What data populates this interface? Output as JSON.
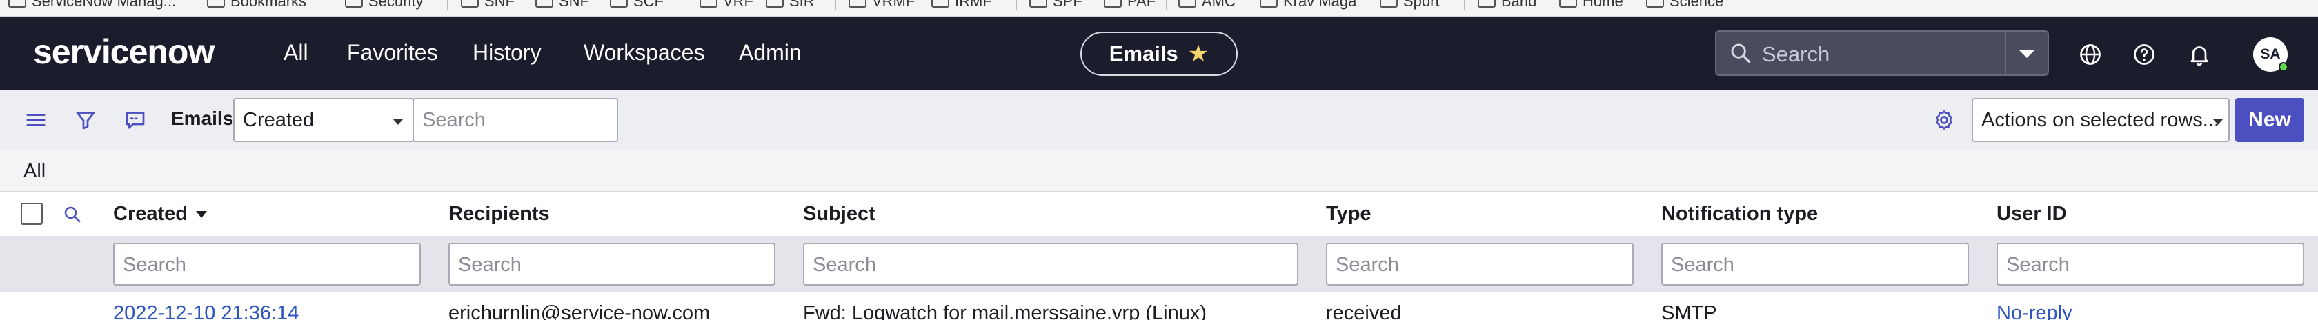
{
  "bookmarks": [
    "ServiceNow Manag...",
    "Bookmarks",
    "Security",
    "SNF",
    "SNF",
    "SCF",
    "VRF",
    "SIR",
    "VRMF",
    "IRMF",
    "SPF",
    "PAF",
    "AMC",
    "Krav Maga",
    "Sport",
    "Band",
    "Home",
    "Science"
  ],
  "nav": {
    "logo": "servicenow",
    "links": [
      "All",
      "Favorites",
      "History",
      "Workspaces",
      "Admin"
    ],
    "context_title": "Emails",
    "search_placeholder": "Search",
    "avatar_initials": "SA"
  },
  "toolbar": {
    "title": "Emails",
    "field_select": "Created",
    "search_placeholder": "Search",
    "actions_select": "Actions on selected rows...",
    "new_label": "New"
  },
  "breadcrumb": "All",
  "table": {
    "columns": [
      "Created",
      "Recipients",
      "Subject",
      "Type",
      "Notification type",
      "User ID"
    ],
    "filter_placeholder": "Search",
    "rows": [
      [
        "2022-12-10 21:36:14",
        "erichurnlin@service-now.com",
        "Fwd: Logwatch for mail.merssaine.vrp (Linux)",
        "received",
        "SMTP",
        "No-reply"
      ]
    ]
  },
  "colors": {
    "nav_bg": "#1c1d2c",
    "accent": "#4b4fbf",
    "logo_green": "#62d84e",
    "link": "#2d56c2"
  }
}
